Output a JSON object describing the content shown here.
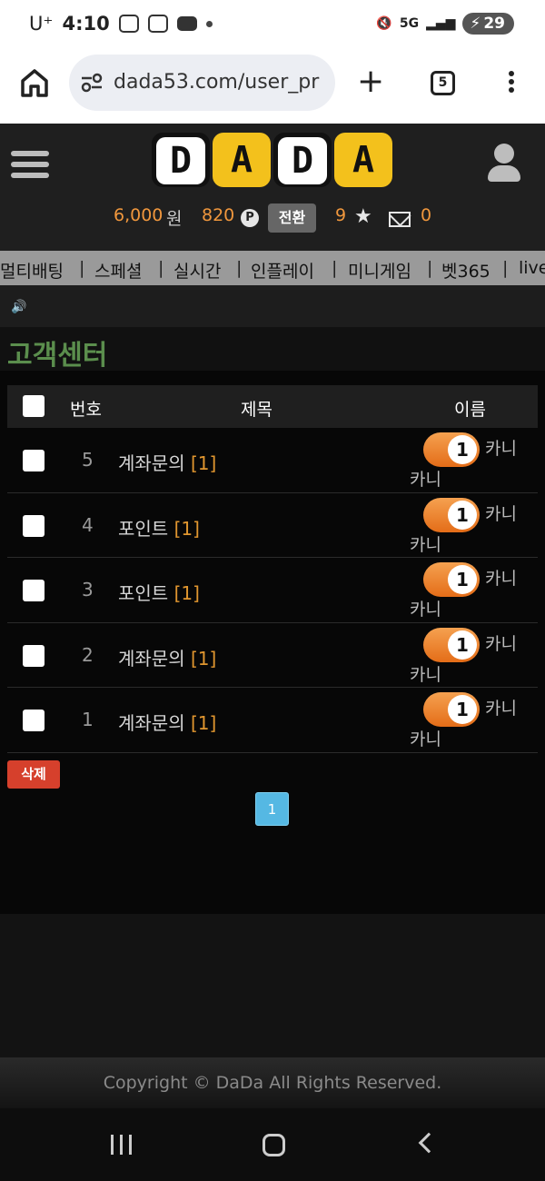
{
  "status_bar": {
    "carrier": "U⁺",
    "time": "4:10",
    "network": "5G",
    "battery": "29"
  },
  "browser": {
    "url": "dada53.com/user_pr",
    "tab_count": "5",
    "new_tab": "+"
  },
  "logo": {
    "letters": [
      "D",
      "A",
      "D",
      "A"
    ]
  },
  "account": {
    "money": "6,000",
    "money_unit": "원",
    "points": "820",
    "points_icon": "P",
    "convert_label": "전환",
    "stars": "9",
    "messages": "0"
  },
  "nav": {
    "items": [
      "멀티배팅",
      "스페셜",
      "실시간",
      "인플레이",
      "미니게임",
      "벳365",
      "live"
    ],
    "separator": "|"
  },
  "page": {
    "title": "고객센터"
  },
  "table": {
    "headers": {
      "number": "번호",
      "subject": "제목",
      "name": "이름"
    },
    "rows": [
      {
        "number": "5",
        "subject": "계좌문의",
        "count": "[1]",
        "level": "1",
        "name": "카니",
        "name2": "카니"
      },
      {
        "number": "4",
        "subject": "포인트",
        "count": "[1]",
        "level": "1",
        "name": "카니",
        "name2": "카니"
      },
      {
        "number": "3",
        "subject": "포인트",
        "count": "[1]",
        "level": "1",
        "name": "카니",
        "name2": "카니"
      },
      {
        "number": "2",
        "subject": "계좌문의",
        "count": "[1]",
        "level": "1",
        "name": "카니",
        "name2": "카니"
      },
      {
        "number": "1",
        "subject": "계좌문의",
        "count": "[1]",
        "level": "1",
        "name": "카니",
        "name2": "카니"
      }
    ]
  },
  "actions": {
    "delete_label": "삭제"
  },
  "pagination": {
    "current": "1"
  },
  "footer": {
    "copyright": "Copyright © DaDa All Rights Reserved."
  },
  "colors": {
    "accent_orange": "#f0973d",
    "title_green": "#5b8e4d",
    "delete_red": "#d6402c",
    "page_blue": "#55b8e3",
    "logo_yellow": "#f3c11c"
  }
}
